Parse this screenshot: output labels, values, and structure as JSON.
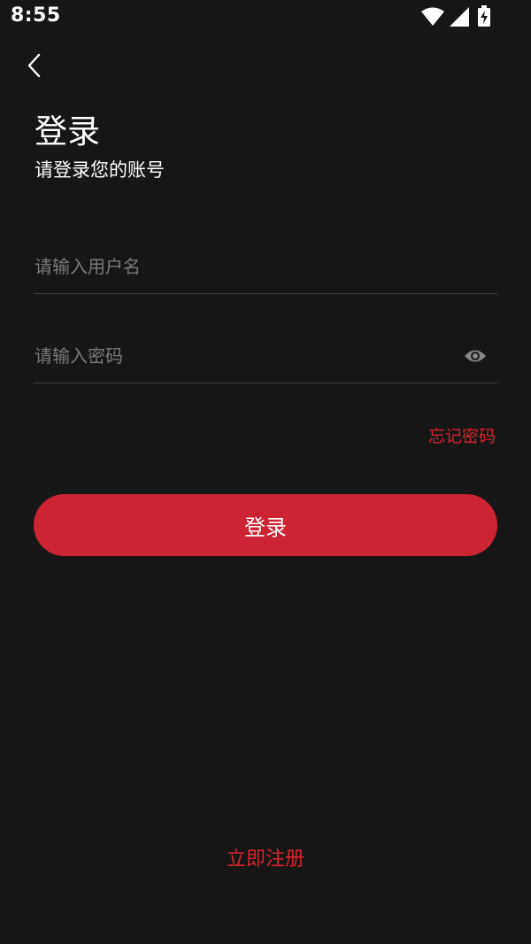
{
  "status_bar": {
    "time": "8:55",
    "icons": [
      "wifi-icon",
      "signal-icon",
      "battery-charging-icon"
    ]
  },
  "header": {
    "back_icon": "chevron-left-icon",
    "title": "登录",
    "subtitle": "请登录您的账号"
  },
  "form": {
    "username": {
      "placeholder": "请输入用户名",
      "value": ""
    },
    "password": {
      "placeholder": "请输入密码",
      "value": "",
      "toggle_icon": "eye-icon"
    },
    "forgot_label": "忘记密码",
    "login_label": "登录"
  },
  "footer": {
    "register_label": "立即注册"
  },
  "colors": {
    "background": "#161616",
    "accent": "#cc2433",
    "link": "#d4232d",
    "placeholder": "#7a7a7a",
    "divider": "#3c3c3c"
  }
}
